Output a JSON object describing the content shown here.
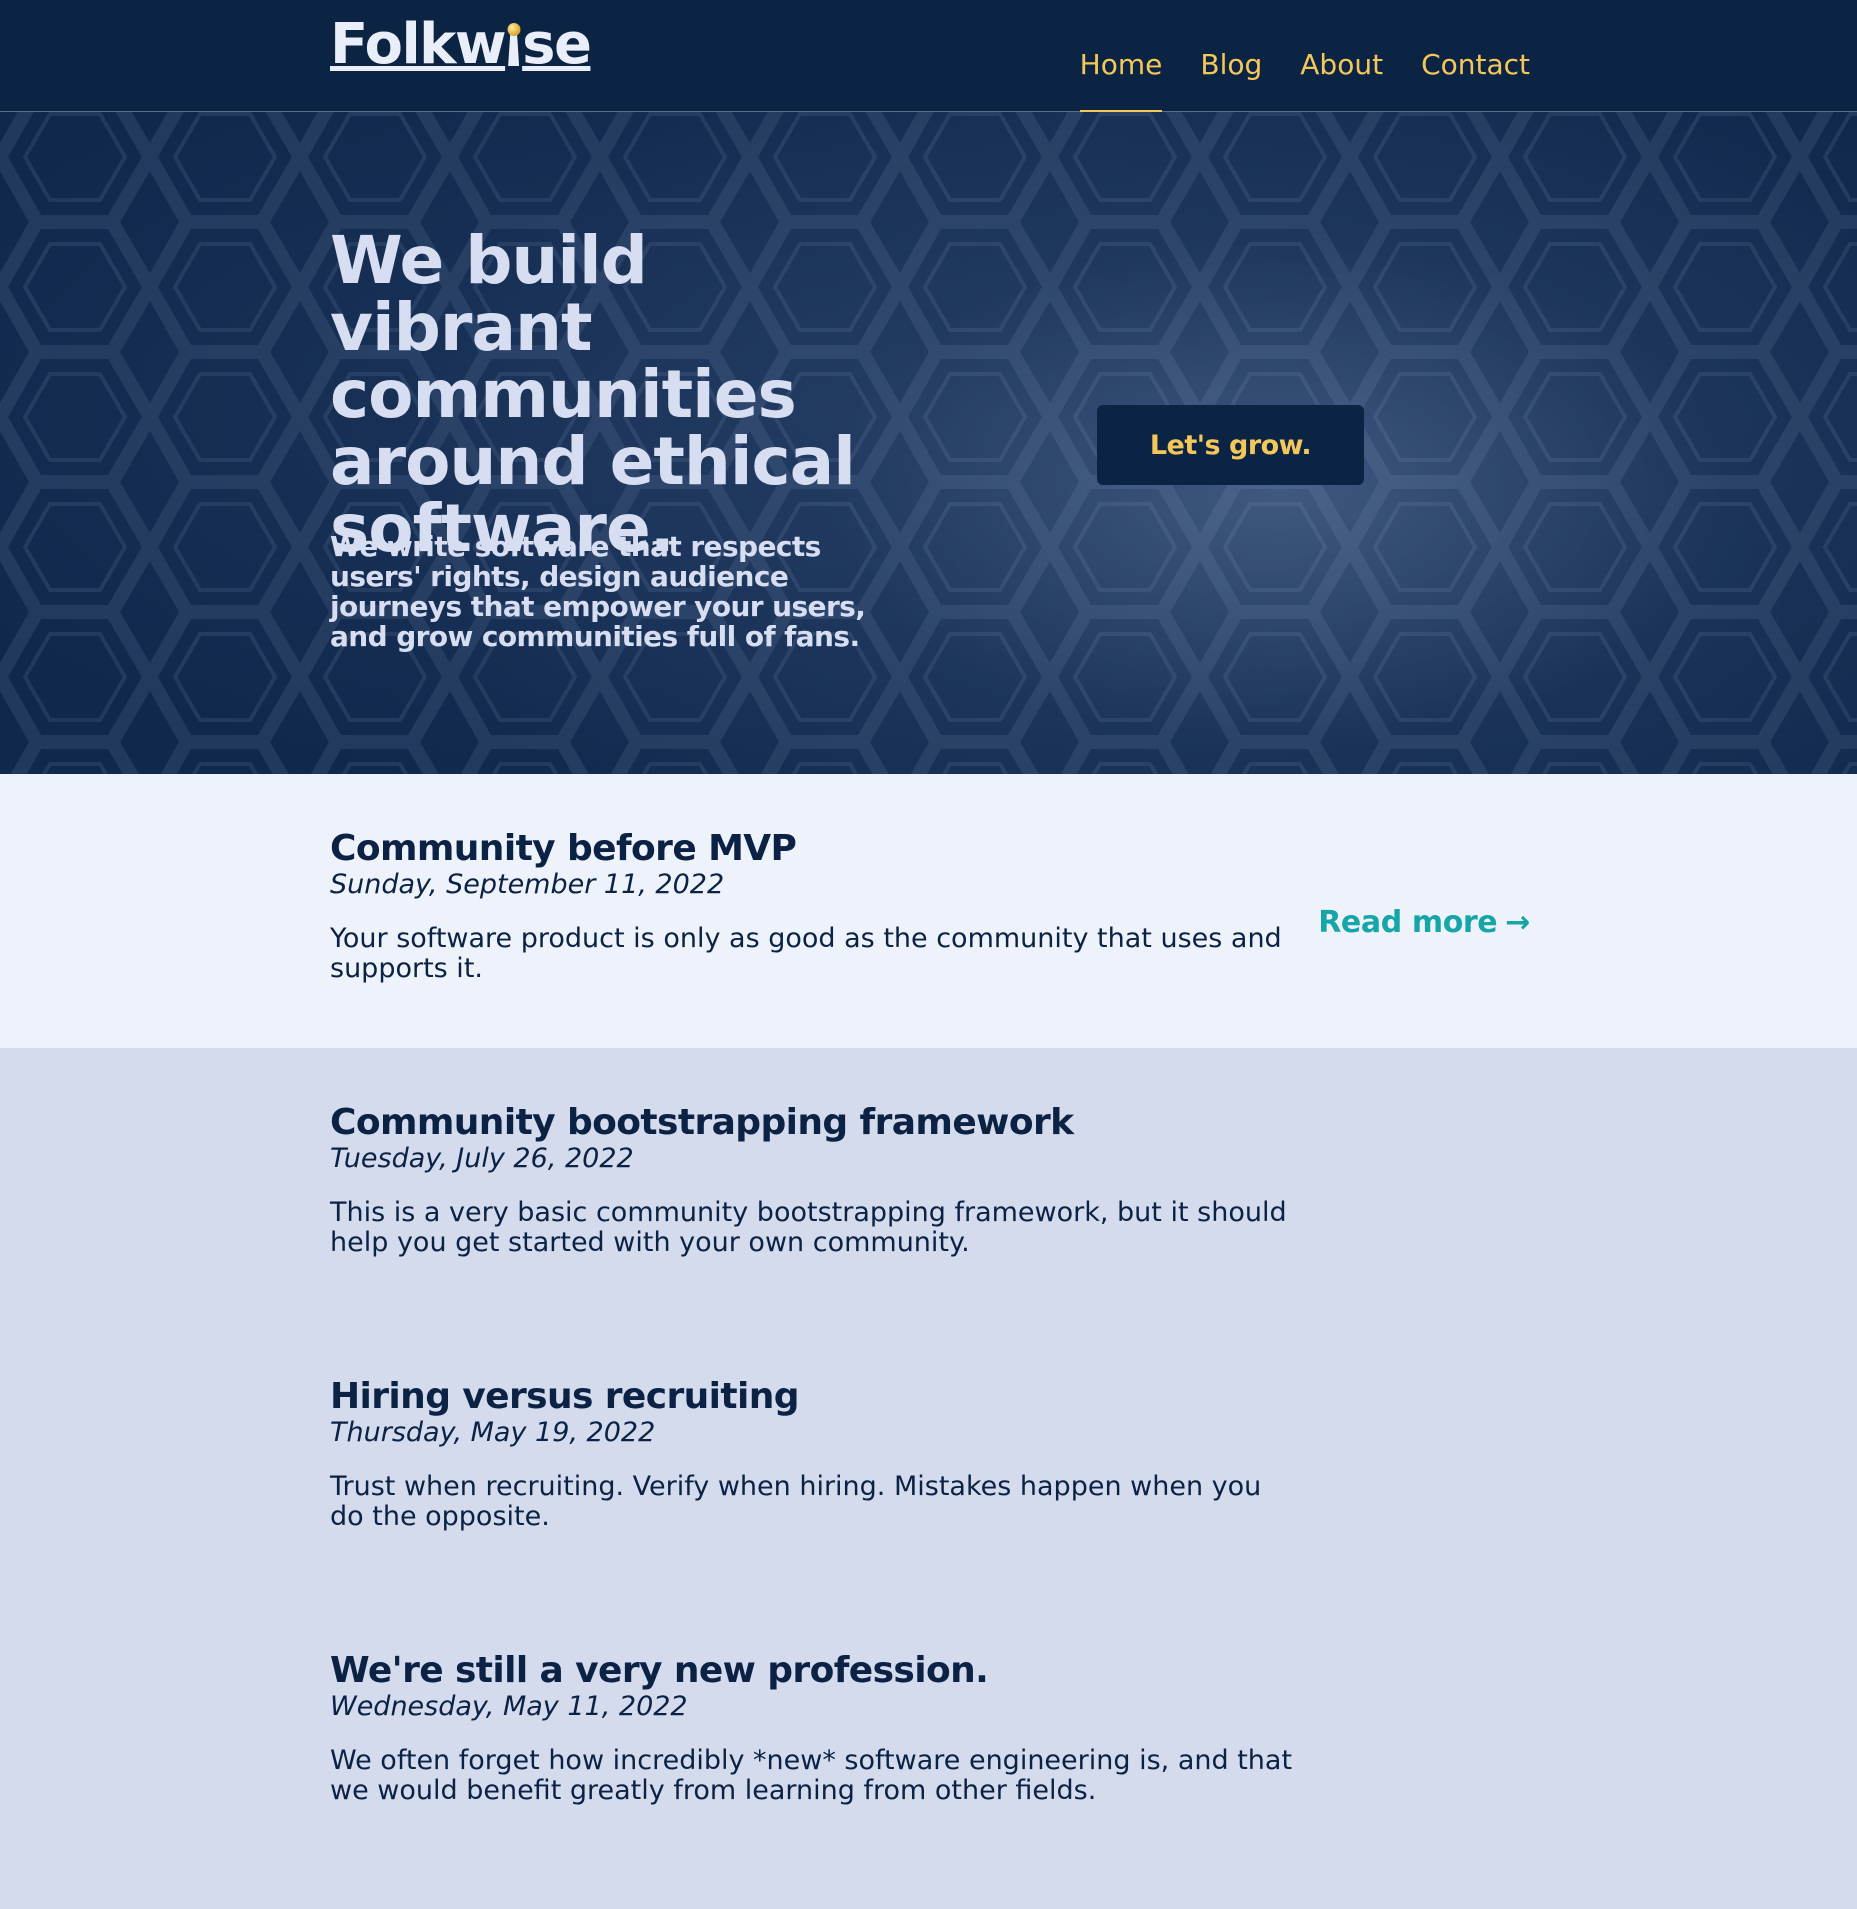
{
  "brand": {
    "logo_prefix": "Folkw",
    "logo_suffix": "se"
  },
  "nav": {
    "items": [
      {
        "label": "Home",
        "active": true
      },
      {
        "label": "Blog"
      },
      {
        "label": "About"
      },
      {
        "label": "Contact"
      }
    ]
  },
  "hero": {
    "title": "We build vibrant communities around ethical software.",
    "subtitle": "We write software that respects users' rights, design audience journeys that empower your users, and grow communities full of fans.",
    "cta_label": "Let's grow."
  },
  "posts": [
    {
      "title": "Community before MVP",
      "date": "Sunday, September 11, 2022",
      "excerpt": "Your software product is only as good as the community that uses and supports it.",
      "read_more": "Read more",
      "read_more_icon": "arrow-right-icon",
      "arrow_glyph": "→"
    },
    {
      "title": "Community bootstrapping framework",
      "date": "Tuesday, July 26, 2022",
      "excerpt": "This is a very basic community bootstrapping framework, but it should help you get started with your own community."
    },
    {
      "title": "Hiring versus recruiting",
      "date": "Thursday, May 19, 2022",
      "excerpt": "Trust when recruiting. Verify when hiring. Mistakes happen when you do the opposite."
    },
    {
      "title": "We're still a very new profession.",
      "date": "Wednesday, May 11, 2022",
      "excerpt": "We often forget how incredibly *new* software engineering is, and that we would benefit greatly from learning from other fields."
    }
  ],
  "colors": {
    "header_bg": "#0c2444",
    "nav_accent": "#f4c75a",
    "hero_text": "#d7def1",
    "featured_bg": "#eef2fa",
    "list_bg": "#d3dbed",
    "link_teal": "#16a6a8",
    "text_dark": "#0b2244"
  }
}
